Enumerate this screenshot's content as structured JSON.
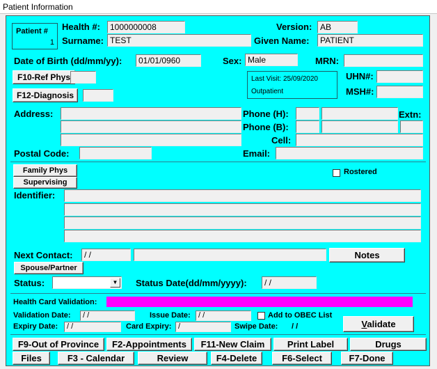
{
  "window": {
    "title": "Patient Information"
  },
  "patient_box": {
    "label": "Patient #",
    "number": "1"
  },
  "labels": {
    "health": "Health #:",
    "version": "Version:",
    "surname": "Surname:",
    "given_name": "Given Name:",
    "dob": "Date of Birth (dd/mm/yy):",
    "sex": "Sex:",
    "mrn": "MRN:",
    "uhn": "UHN#:",
    "msh": "MSH#:",
    "address": "Address:",
    "phone_h": "Phone (H):",
    "phone_b": "Phone (B):",
    "extn": "Extn:",
    "cell": "Cell:",
    "postal": "Postal Code:",
    "email": "Email:",
    "rostered": "Rostered",
    "identifier": "Identifier:",
    "next_contact": "Next Contact:",
    "status": "Status:",
    "status_date": "Status Date(dd/mm/yyyy):",
    "hc_validation": "Health Card Validation:",
    "validation_date": "Validation Date:",
    "issue_date": "Issue Date:",
    "add_obec": "Add to OBEC List",
    "expiry_date": "Expiry Date:",
    "card_expiry": "Card Expiry:",
    "swipe_date": "Swipe Date:"
  },
  "values": {
    "health": "1000000008",
    "version": "AB",
    "surname": "TEST",
    "given_name": "PATIENT",
    "dob": "01/01/0960",
    "sex": "Male",
    "next_contact": "/ /",
    "status_date": "/ /",
    "validation_date": "/ /",
    "issue_date": "/ /",
    "expiry_date": "/ /",
    "card_expiry": "/",
    "swipe_date": "/ /"
  },
  "last_visit": {
    "line1": "Last Visit: 25/09/2020",
    "line2": "Outpatient"
  },
  "buttons": {
    "ref_phys": "F10-Ref Phys",
    "diagnosis": "F12-Diagnosis",
    "family_phys": "Family Phys",
    "supervising": "Supervising",
    "notes": "Notes",
    "spouse": "Spouse/Partner",
    "validate": "Validate"
  },
  "fkeys": {
    "row1": [
      "F9-Out of Province",
      "F2-Appointments",
      "F11-New Claim",
      "Print Label",
      "Drugs"
    ],
    "row2": [
      "Files",
      "F3 - Calendar",
      "Review",
      "F4-Delete",
      "F6-Select",
      "F7-Done"
    ]
  },
  "colors": {
    "panel": "#00ffff",
    "validation_bar": "#ff00ff"
  }
}
